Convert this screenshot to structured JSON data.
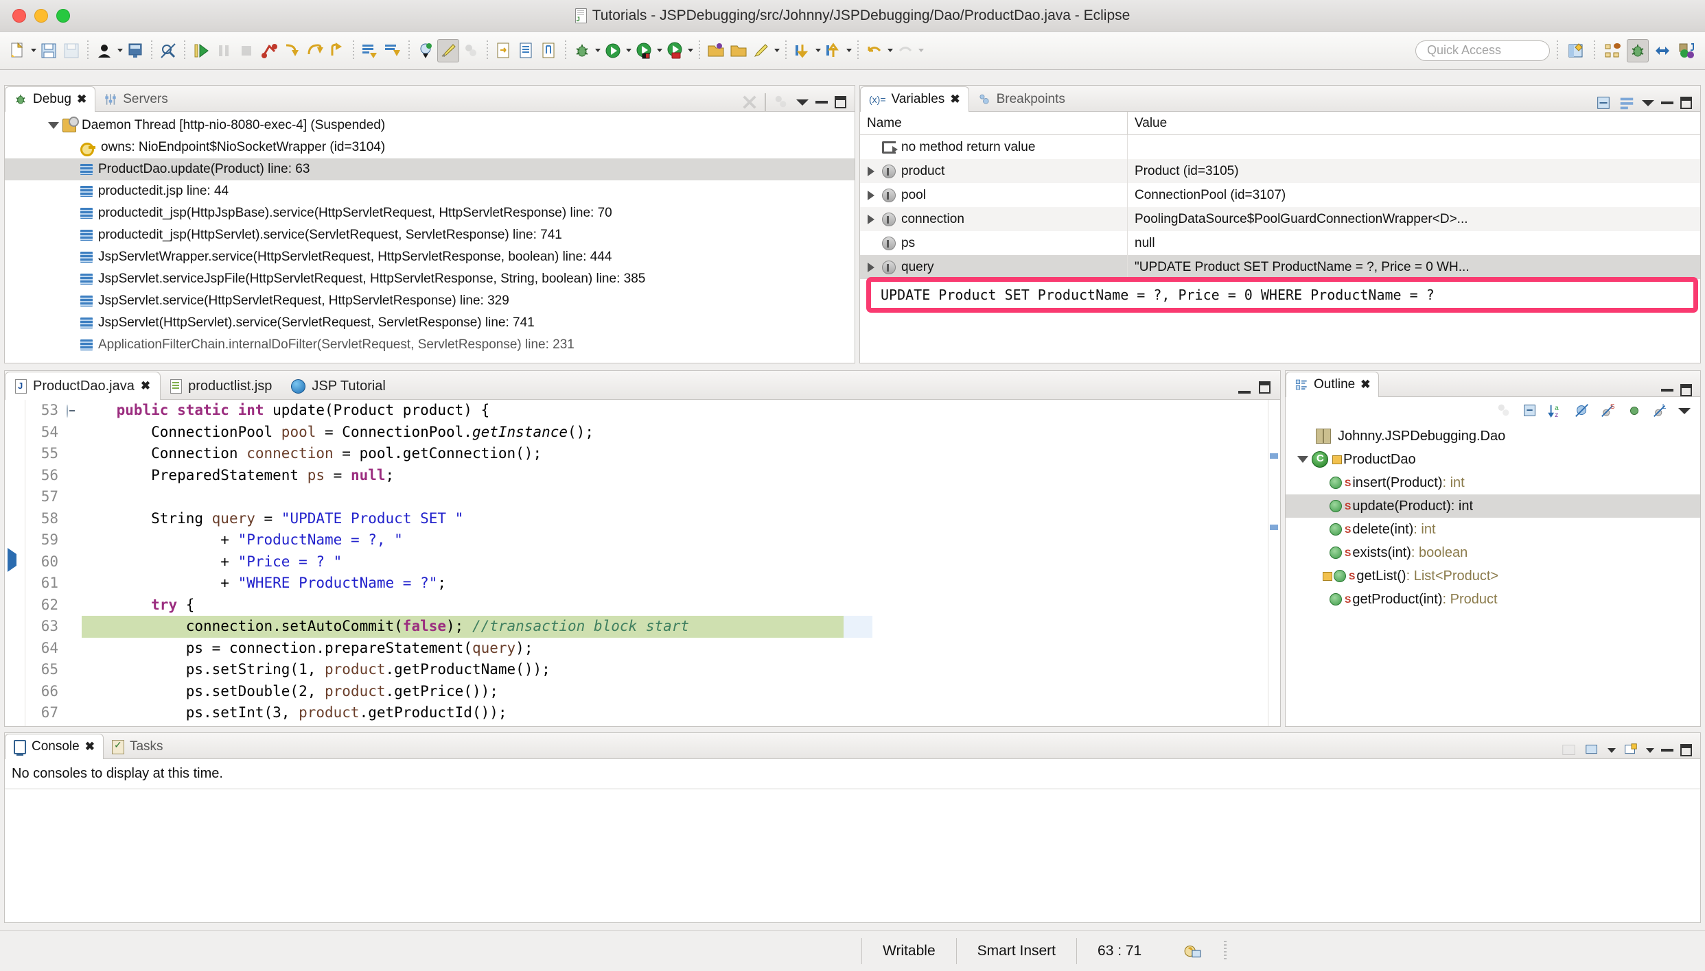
{
  "window": {
    "title": "Tutorials - JSPDebugging/src/Johnny/JSPDebugging/Dao/ProductDao.java - Eclipse",
    "file_icon": "java-file-icon"
  },
  "toolbar": {
    "quick_access_placeholder": "Quick Access",
    "items": [
      "new-icon",
      "save-icon",
      "save-all-icon",
      "person-icon",
      "terminal-icon",
      "no-link-icon",
      "resume-icon",
      "suspend-icon",
      "terminate-icon",
      "disconnect-icon",
      "step-into-icon",
      "step-over-icon",
      "step-return-icon",
      "drop-to-frame-icon",
      "step-filter-icon",
      "instance-icon",
      "highlight-icon",
      "pointer-icon",
      "open-type-icon",
      "open-task-icon",
      "mark-occurrence-icon",
      "debug-icon",
      "run-icon",
      "coverage-icon",
      "run-ext-icon",
      "open-folder-icon",
      "ps-icon",
      "pencil-icon",
      "next-annotation-icon",
      "prev-annotation-icon",
      "back-icon",
      "forward-icon"
    ],
    "perspectives": [
      "open-perspective-icon",
      "java-ee-icon",
      "debug-perspective-icon",
      "web-icon",
      "java-icon"
    ]
  },
  "debug_panel": {
    "tabs": [
      {
        "label": "Debug",
        "icon": "bug-icon",
        "selected": true,
        "closable": true
      },
      {
        "label": "Servers",
        "icon": "servers-icon",
        "selected": false,
        "closable": false
      }
    ],
    "view_icons": [
      "disconnect-all-icon",
      "threads-icon",
      "view-menu-icon",
      "minimize-icon",
      "maximize-icon"
    ],
    "thread": {
      "label": "Daemon Thread [http-nio-8080-exec-4] (Suspended)",
      "icon": "thread-icon",
      "expanded": true
    },
    "stack_frames": [
      {
        "label": "owns: NioEndpoint$NioSocketWrapper  (id=3104)",
        "icon": "monitor-key-icon",
        "selected": false,
        "indent": 2
      },
      {
        "label": "ProductDao.update(Product) line: 63",
        "icon": "stack-frame-icon",
        "selected": true,
        "indent": 2
      },
      {
        "label": "productedit.jsp line: 44",
        "icon": "stack-frame-icon",
        "selected": false,
        "indent": 2
      },
      {
        "label": "productedit_jsp(HttpJspBase).service(HttpServletRequest, HttpServletResponse) line: 70",
        "icon": "stack-frame-icon",
        "selected": false,
        "indent": 2
      },
      {
        "label": "productedit_jsp(HttpServlet).service(ServletRequest, ServletResponse) line: 741",
        "icon": "stack-frame-icon",
        "selected": false,
        "indent": 2
      },
      {
        "label": "JspServletWrapper.service(HttpServletRequest, HttpServletResponse, boolean) line: 444",
        "icon": "stack-frame-icon",
        "selected": false,
        "indent": 2
      },
      {
        "label": "JspServlet.serviceJspFile(HttpServletRequest, HttpServletResponse, String, boolean) line: 385",
        "icon": "stack-frame-icon",
        "selected": false,
        "indent": 2
      },
      {
        "label": "JspServlet.service(HttpServletRequest, HttpServletResponse) line: 329",
        "icon": "stack-frame-icon",
        "selected": false,
        "indent": 2
      },
      {
        "label": "JspServlet(HttpServlet).service(ServletRequest, ServletResponse) line: 741",
        "icon": "stack-frame-icon",
        "selected": false,
        "indent": 2
      },
      {
        "label": "ApplicationFilterChain.internalDoFilter(ServletRequest, ServletResponse) line: 231",
        "icon": "stack-frame-icon",
        "selected": false,
        "indent": 2
      }
    ]
  },
  "variables_panel": {
    "tabs": [
      {
        "label": "Variables",
        "icon": "variables-icon",
        "selected": true,
        "closable": true
      },
      {
        "label": "Breakpoints",
        "icon": "breakpoints-icon",
        "selected": false,
        "closable": false
      }
    ],
    "view_icons": [
      "collapse-all-icon",
      "show-logical-icon",
      "layout-icon",
      "view-menu-icon",
      "minimize-icon",
      "maximize-icon"
    ],
    "columns": [
      "Name",
      "Value"
    ],
    "rows": [
      {
        "name": "no method return value",
        "value": "",
        "icon": "method-return-icon",
        "expandable": false,
        "selected": false
      },
      {
        "name": "product",
        "value": "Product  (id=3105)",
        "icon": "object-icon",
        "expandable": true,
        "selected": false
      },
      {
        "name": "pool",
        "value": "ConnectionPool  (id=3107)",
        "icon": "object-icon",
        "expandable": true,
        "selected": false
      },
      {
        "name": "connection",
        "value": "PoolingDataSource$PoolGuardConnectionWrapper<D>...",
        "icon": "object-icon",
        "expandable": true,
        "selected": false
      },
      {
        "name": "ps",
        "value": "null",
        "icon": "object-icon",
        "expandable": false,
        "selected": false
      },
      {
        "name": "query",
        "value": "\"UPDATE Product SET ProductName = ?, Price = 0 WH...",
        "icon": "object-icon",
        "expandable": true,
        "selected": true
      }
    ]
  },
  "sql_highlight": {
    "text": "UPDATE Product SET ProductName = ?, Price = 0 WHERE ProductName = ?",
    "border_color": "#f93a70"
  },
  "editor": {
    "tabs": [
      {
        "label": "ProductDao.java",
        "icon": "java-file-icon",
        "selected": true,
        "closable": true
      },
      {
        "label": "productlist.jsp",
        "icon": "jsp-file-icon",
        "selected": false,
        "closable": false
      },
      {
        "label": "JSP Tutorial",
        "icon": "browser-globe-icon",
        "selected": false,
        "closable": false
      }
    ],
    "view_icons": [
      "minimize-icon",
      "maximize-icon"
    ],
    "lines": [
      {
        "no": "53",
        "fold": true,
        "marker": "",
        "highlighted": false,
        "tokens": [
          {
            "t": "    ",
            "c": ""
          },
          {
            "t": "public static int ",
            "c": "k-kw"
          },
          {
            "t": "update(Product product) {",
            "c": ""
          }
        ]
      },
      {
        "no": "54",
        "fold": false,
        "marker": "",
        "highlighted": false,
        "tokens": [
          {
            "t": "        ConnectionPool ",
            "c": ""
          },
          {
            "t": "pool",
            "c": "k-fld"
          },
          {
            "t": " = ConnectionPool.",
            "c": ""
          },
          {
            "t": "getInstance",
            "c": "k-mi"
          },
          {
            "t": "();",
            "c": ""
          }
        ]
      },
      {
        "no": "55",
        "fold": false,
        "marker": "",
        "highlighted": false,
        "tokens": [
          {
            "t": "        Connection ",
            "c": ""
          },
          {
            "t": "connection",
            "c": "k-fld"
          },
          {
            "t": " = pool.getConnection();",
            "c": ""
          }
        ]
      },
      {
        "no": "56",
        "fold": false,
        "marker": "",
        "highlighted": false,
        "tokens": [
          {
            "t": "        PreparedStatement ",
            "c": ""
          },
          {
            "t": "ps",
            "c": "k-fld"
          },
          {
            "t": " = ",
            "c": ""
          },
          {
            "t": "null",
            "c": "k-kw"
          },
          {
            "t": ";",
            "c": ""
          }
        ]
      },
      {
        "no": "57",
        "fold": false,
        "marker": "",
        "highlighted": false,
        "tokens": [
          {
            "t": "",
            "c": ""
          }
        ]
      },
      {
        "no": "58",
        "fold": false,
        "marker": "breakpoint",
        "highlighted": false,
        "tokens": [
          {
            "t": "        String ",
            "c": ""
          },
          {
            "t": "query",
            "c": "k-fld"
          },
          {
            "t": " = ",
            "c": ""
          },
          {
            "t": "\"UPDATE Product SET \"",
            "c": "k-str"
          }
        ]
      },
      {
        "no": "59",
        "fold": false,
        "marker": "",
        "highlighted": false,
        "tokens": [
          {
            "t": "                + ",
            "c": ""
          },
          {
            "t": "\"ProductName = ?, \"",
            "c": "k-str"
          }
        ]
      },
      {
        "no": "60",
        "fold": false,
        "marker": "",
        "highlighted": false,
        "tokens": [
          {
            "t": "                + ",
            "c": ""
          },
          {
            "t": "\"Price = ? \"",
            "c": "k-str"
          }
        ]
      },
      {
        "no": "61",
        "fold": false,
        "marker": "",
        "highlighted": false,
        "tokens": [
          {
            "t": "                + ",
            "c": ""
          },
          {
            "t": "\"WHERE ProductName = ?\"",
            "c": "k-str"
          },
          {
            "t": ";",
            "c": ""
          }
        ]
      },
      {
        "no": "62",
        "fold": false,
        "marker": "",
        "highlighted": false,
        "tokens": [
          {
            "t": "        ",
            "c": ""
          },
          {
            "t": "try",
            "c": "k-kw"
          },
          {
            "t": " {",
            "c": ""
          }
        ]
      },
      {
        "no": "63",
        "fold": false,
        "marker": "current",
        "highlighted": true,
        "tokens": [
          {
            "t": "            connection.setAutoCommit(",
            "c": ""
          },
          {
            "t": "false",
            "c": "k-kw"
          },
          {
            "t": "); ",
            "c": ""
          },
          {
            "t": "//transaction block start",
            "c": "k-cmt"
          }
        ]
      },
      {
        "no": "64",
        "fold": false,
        "marker": "",
        "highlighted": false,
        "tokens": [
          {
            "t": "            ps = connection.prepareStatement(",
            "c": ""
          },
          {
            "t": "query",
            "c": "k-fld"
          },
          {
            "t": ");",
            "c": ""
          }
        ]
      },
      {
        "no": "65",
        "fold": false,
        "marker": "",
        "highlighted": false,
        "tokens": [
          {
            "t": "            ps.setString(1, ",
            "c": ""
          },
          {
            "t": "product",
            "c": "k-fld"
          },
          {
            "t": ".getProductName());",
            "c": ""
          }
        ]
      },
      {
        "no": "66",
        "fold": false,
        "marker": "",
        "highlighted": false,
        "tokens": [
          {
            "t": "            ps.setDouble(2, ",
            "c": ""
          },
          {
            "t": "product",
            "c": "k-fld"
          },
          {
            "t": ".getPrice());",
            "c": ""
          }
        ]
      },
      {
        "no": "67",
        "fold": false,
        "marker": "",
        "highlighted": false,
        "tokens": [
          {
            "t": "            ps.setInt(3, ",
            "c": ""
          },
          {
            "t": "product",
            "c": "k-fld"
          },
          {
            "t": ".getProductId());",
            "c": ""
          }
        ]
      }
    ]
  },
  "outline_panel": {
    "tabs": [
      {
        "label": "Outline",
        "icon": "outline-icon",
        "selected": true,
        "closable": true
      }
    ],
    "view_icons": [
      "sort-icon",
      "collapse-all-icon",
      "hide-fields-icon",
      "hide-static-icon",
      "hide-nonpublic-icon",
      "hide-local-icon",
      "view-menu-icon",
      "minimize-icon",
      "maximize-icon"
    ],
    "items": [
      {
        "label": "Johnny.JSPDebugging.Dao",
        "kind": "package",
        "icon": "package-icon",
        "indent": 1,
        "selected": false,
        "ret": ""
      },
      {
        "label": "ProductDao",
        "kind": "class",
        "icon": "class-icon",
        "indent": 0,
        "selected": false,
        "ret": "",
        "expanded": true,
        "warning": true
      },
      {
        "label": "insert(Product)",
        "kind": "method",
        "icon": "method-icon",
        "indent": 2,
        "selected": false,
        "ret": " : int"
      },
      {
        "label": "update(Product)",
        "kind": "method",
        "icon": "method-icon",
        "indent": 2,
        "selected": true,
        "ret": " : int"
      },
      {
        "label": "delete(int)",
        "kind": "method",
        "icon": "method-icon",
        "indent": 2,
        "selected": false,
        "ret": " : int"
      },
      {
        "label": "exists(int)",
        "kind": "method",
        "icon": "method-icon",
        "indent": 2,
        "selected": false,
        "ret": " : boolean"
      },
      {
        "label": "getList()",
        "kind": "method",
        "icon": "method-icon",
        "indent": 2,
        "selected": false,
        "ret": " : List<Product>",
        "warning": true
      },
      {
        "label": "getProduct(int)",
        "kind": "method",
        "icon": "method-icon",
        "indent": 2,
        "selected": false,
        "ret": " : Product"
      }
    ]
  },
  "console_panel": {
    "tabs": [
      {
        "label": "Console",
        "icon": "console-icon",
        "selected": true,
        "closable": true
      },
      {
        "label": "Tasks",
        "icon": "tasks-icon",
        "selected": false,
        "closable": false
      }
    ],
    "view_icons": [
      "open-console-icon",
      "display-selected-icon",
      "new-console-icon",
      "minimize-icon",
      "maximize-icon"
    ],
    "message": "No consoles to display at this time."
  },
  "status_bar": {
    "writable": "Writable",
    "insert_mode": "Smart Insert",
    "cursor_position": "63 : 71",
    "icon": "build-icon"
  }
}
